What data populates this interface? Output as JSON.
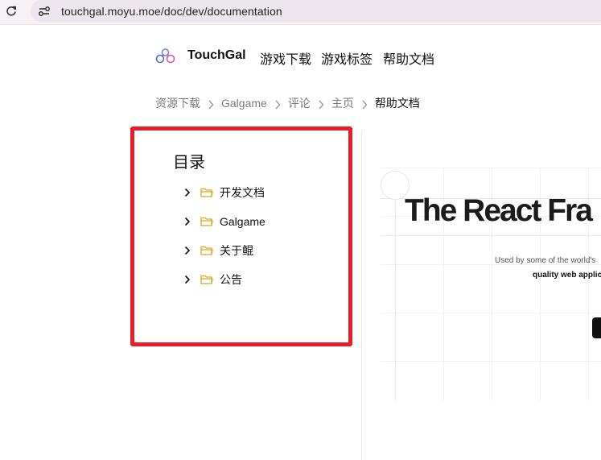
{
  "browser": {
    "url": "touchgal.moyu.moe/doc/dev/documentation"
  },
  "header": {
    "brand": "TouchGal",
    "nav": [
      "游戏下载",
      "游戏标签",
      "帮助文档"
    ]
  },
  "breadcrumb": {
    "items": [
      "资源下载",
      "Galgame",
      "评论",
      "主页",
      "帮助文档"
    ]
  },
  "toc": {
    "title": "目录",
    "items": [
      {
        "label": "开发文档"
      },
      {
        "label": "Galgame"
      },
      {
        "label": "关于鲲"
      },
      {
        "label": "公告"
      }
    ]
  },
  "preview": {
    "title": "The React Fra",
    "line1": "Used by some of the world's",
    "line2": "quality web applic"
  },
  "colors": {
    "highlight": "#e41f2b",
    "folder": "#e0a428",
    "accent_logo": "#4a6fd8"
  },
  "icons": {
    "reload": "reload-icon",
    "site_info": "site-info-icon",
    "logo": "touchgal-logo-icon",
    "chevron": "chevron-right-icon",
    "folder": "folder-icon"
  }
}
